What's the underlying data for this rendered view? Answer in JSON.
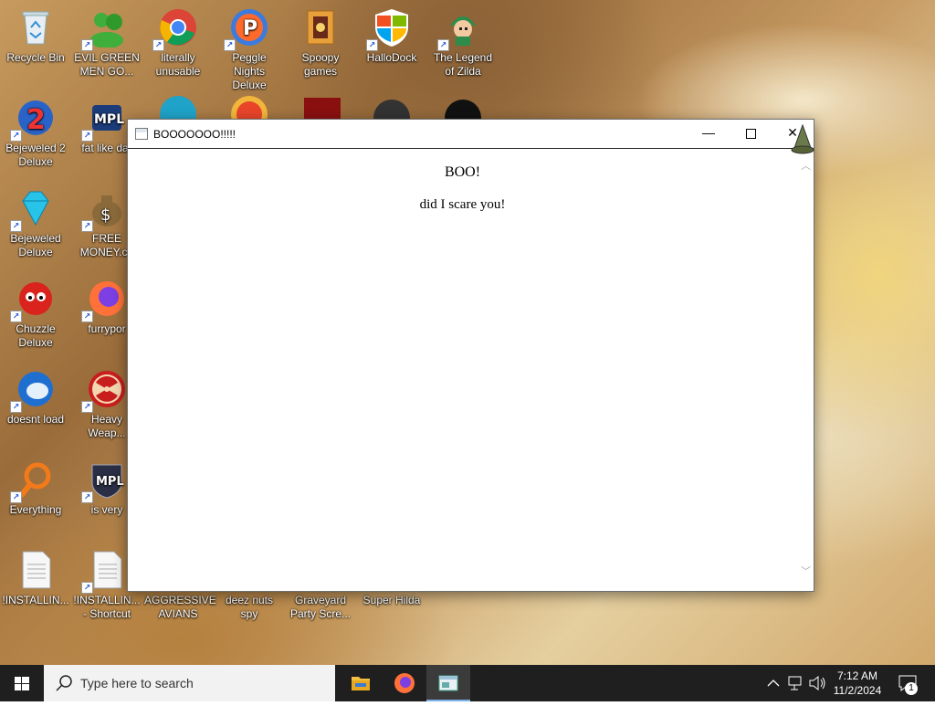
{
  "desktop": {
    "icons": [
      {
        "label": "Recycle Bin",
        "icon": "recycle-bin-icon"
      },
      {
        "label": "EVIL GREEN MEN GO...",
        "icon": "green-men-icon"
      },
      {
        "label": "literally unusable",
        "icon": "chrome-icon"
      },
      {
        "label": "Peggle Nights Deluxe",
        "icon": "peggle-icon"
      },
      {
        "label": "Spoopy games",
        "icon": "folder-games-icon"
      },
      {
        "label": "HalloDock",
        "icon": "windows-shield-icon"
      },
      {
        "label": "The Legend of Zilda",
        "icon": "zelda-icon"
      },
      {
        "label": "Bejeweled 2 Deluxe",
        "icon": "bejeweled2-icon"
      },
      {
        "label": "fat like dar",
        "icon": "mpl-icon"
      },
      {
        "label": "Bejeweled Deluxe",
        "icon": "diamond-icon"
      },
      {
        "label": "FREE MONEY.co",
        "icon": "money-bag-icon"
      },
      {
        "label": "Chuzzle Deluxe",
        "icon": "chuzzle-icon"
      },
      {
        "label": "furrypor",
        "icon": "firefox-icon"
      },
      {
        "label": "doesnt load",
        "icon": "thunderbird-icon"
      },
      {
        "label": "Heavy Weap...",
        "icon": "radiation-icon"
      },
      {
        "label": "Everything",
        "icon": "search-magnifier-icon"
      },
      {
        "label": "is very",
        "icon": "mpl-shield-icon"
      },
      {
        "label": "!INSTALLIN...",
        "icon": "text-file-icon"
      },
      {
        "label": "!INSTALLIN... - Shortcut",
        "icon": "text-file-icon"
      },
      {
        "label": "AGGRESSIVE AVIANS",
        "icon": "birds-icon"
      },
      {
        "label": "deez nuts spy",
        "icon": "spy-icon"
      },
      {
        "label": "Graveyard Party Scre...",
        "icon": "graveyard-icon"
      },
      {
        "label": "Super Hilda",
        "icon": "hilda-icon"
      }
    ]
  },
  "window": {
    "title": "BOOOOOOO!!!!!",
    "heading": "BOO!",
    "message": "did I scare you!",
    "minimize": "—",
    "close": "✕"
  },
  "taskbar": {
    "search_placeholder": "Type here to search",
    "time": "7:12 AM",
    "date": "11/2/2024",
    "notification_count": "1"
  },
  "colors": {
    "taskbar": "#1f1f1f",
    "active_underline": "#7fb2ea",
    "window_bg": "#ffffff"
  }
}
